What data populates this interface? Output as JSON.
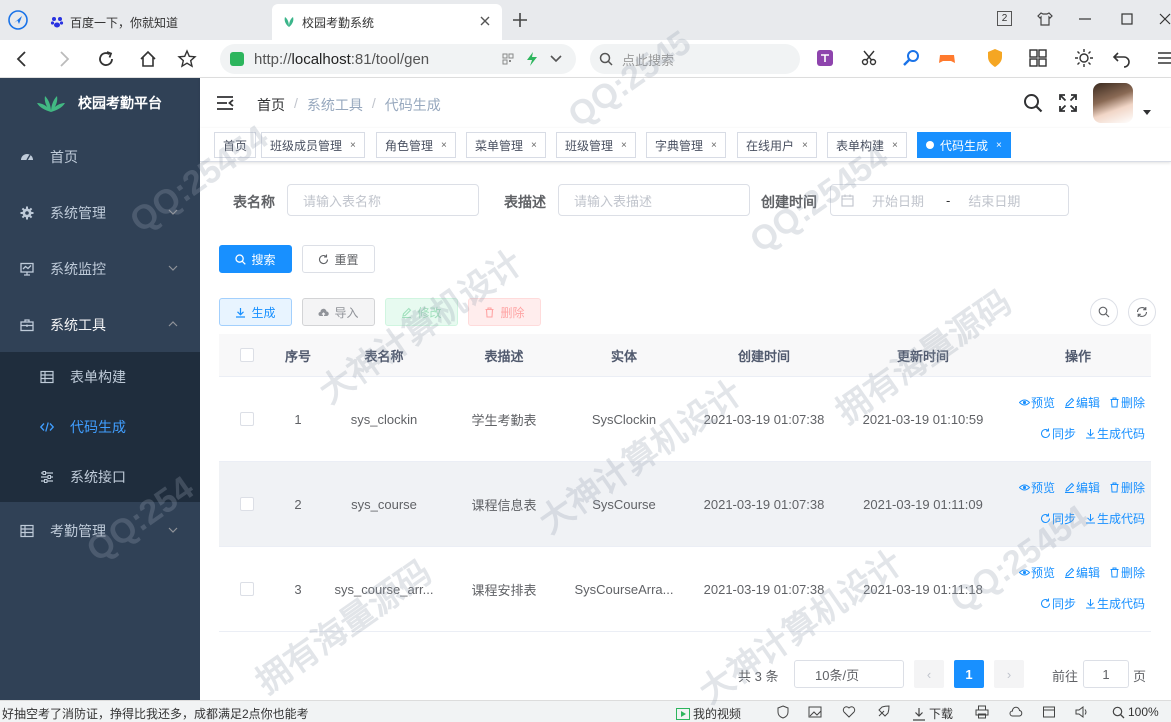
{
  "browser": {
    "tabs": [
      {
        "title": "百度一下，你就知道",
        "active": false
      },
      {
        "title": "校园考勤系统",
        "active": true
      }
    ],
    "url_scheme": "http://",
    "url_host": "localhost",
    "url_rest": ":81/tool/gen",
    "search_placeholder": "点此搜索",
    "tab_count_badge": "2"
  },
  "sidebar": {
    "title": "校园考勤平台",
    "items": [
      {
        "label": "首页",
        "icon": "dashboard-icon"
      },
      {
        "label": "系统管理",
        "icon": "gear-icon",
        "expandable": true
      },
      {
        "label": "系统监控",
        "icon": "monitor-icon",
        "expandable": true
      },
      {
        "label": "系统工具",
        "icon": "toolbox-icon",
        "expandable": true,
        "expanded": true
      },
      {
        "label": "考勤管理",
        "icon": "table-icon",
        "expandable": true
      }
    ],
    "subitems": [
      {
        "label": "表单构建",
        "icon": "table-icon"
      },
      {
        "label": "代码生成",
        "icon": "code-icon",
        "active": true
      },
      {
        "label": "系统接口",
        "icon": "sliders-icon"
      }
    ]
  },
  "header": {
    "breadcrumb": [
      "首页",
      "系统工具",
      "代码生成"
    ]
  },
  "tags": [
    "首页",
    "班级成员管理",
    "角色管理",
    "菜单管理",
    "班级管理",
    "字典管理",
    "在线用户",
    "表单构建",
    "代码生成"
  ],
  "search_form": {
    "table_name_label": "表名称",
    "table_name_placeholder": "请输入表名称",
    "table_desc_label": "表描述",
    "table_desc_placeholder": "请输入表描述",
    "created_label": "创建时间",
    "start_placeholder": "开始日期",
    "range_sep": "-",
    "end_placeholder": "结束日期",
    "search_button": "搜索",
    "reset_button": "重置"
  },
  "toolbar": {
    "generate": "生成",
    "import": "导入",
    "edit": "修改",
    "delete": "删除"
  },
  "table": {
    "columns": [
      "序号",
      "表名称",
      "表描述",
      "实体",
      "创建时间",
      "更新时间",
      "操作"
    ],
    "rows": [
      {
        "index": "1",
        "name": "sys_clockin",
        "desc": "学生考勤表",
        "entity": "SysClockin",
        "created": "2021-03-19 01:07:38",
        "updated": "2021-03-19 01:10:59"
      },
      {
        "index": "2",
        "name": "sys_course",
        "desc": "课程信息表",
        "entity": "SysCourse",
        "created": "2021-03-19 01:07:38",
        "updated": "2021-03-19 01:11:09"
      },
      {
        "index": "3",
        "name": "sys_course_arr...",
        "desc": "课程安排表",
        "entity": "SysCourseArra...",
        "created": "2021-03-19 01:07:38",
        "updated": "2021-03-19 01:11:18"
      }
    ],
    "actions": {
      "preview": "预览",
      "edit": "编辑",
      "delete": "删除",
      "sync": "同步",
      "gen_code": "生成代码"
    }
  },
  "pagination": {
    "total": "共 3 条",
    "page_size": "10条/页",
    "current_page": "1",
    "goto_prefix": "前往",
    "goto_value": "1",
    "goto_suffix": "页"
  },
  "statusbar": {
    "news": "好抽空考了消防证，挣得比我还多，成都满足2点你也能考",
    "video": "我的视频",
    "download": "下载",
    "zoom": "100%"
  },
  "colors": {
    "primary": "#1890ff",
    "sidebar_bg": "#304156",
    "submenu_bg": "#1f2d3d",
    "active_menu": "#409eff"
  }
}
